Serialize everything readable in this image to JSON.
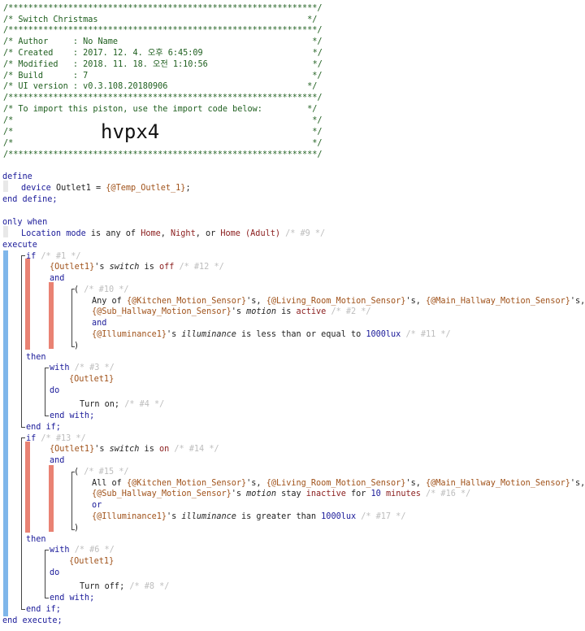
{
  "header": {
    "rule": "/**************************************************************/",
    "title_row": "/* Switch Christmas                                          */",
    "author_row": "/* Author     : No Name                                       */",
    "created_row": "/* Created    : 2017. 12. 4. 오후 6:45:09                      */",
    "modified_row": "/* Modified   : 2018. 11. 18. 오전 1:10:56                     */",
    "build_row": "/* Build      : 7                                             */",
    "ui_row": "/* UI version : v0.3.108.20180906                            */",
    "import_row": "/* To import this piston, use the import code below:         */",
    "blank_row": "/*                                                            */",
    "import_code": "hvpx4"
  },
  "code": {
    "define": "define",
    "device_kw": "device",
    "device_name": "Outlet1",
    "eq": " = ",
    "device_value": "{@Temp_Outlet_1}",
    "semi": ";",
    "end_define": "end define;",
    "only_when": "only when",
    "location_mode": "Location mode",
    "is_any_of": " is any of ",
    "mode_home": "Home",
    "comma": ", ",
    "mode_night": "Night",
    "or_text": ", or ",
    "mode_home_adult": "Home (Adult)",
    "cond9": "/* #9 */",
    "execute": "execute",
    "if1": "if",
    "c1": "/* #1 */",
    "outlet_ref": "{Outlet1}",
    "apos_s": "'s ",
    "switch_attr": "switch",
    "is_text": " is ",
    "off_val": "off",
    "c12": "/* #12 */",
    "and_text": "and",
    "paren_open": "(",
    "c10": "/* #10 */",
    "any_of": "Any of ",
    "kitchen": "{@Kitchen_Motion_Sensor}",
    "apos_s_comma": "'s, ",
    "living": "{@Living_Room_Motion_Sensor}",
    "main_hall": "{@Main_Hallway_Motion_Sensor}",
    "apos_s_or": "'s, or",
    "sub_hall": "{@Sub_Hallway_Motion_Sensor}",
    "motion_attr": "motion",
    "active_val": "active",
    "c2": "/* #2 */",
    "illum_ref": "{@Illuminance1}",
    "illum_attr": "illuminance",
    "less_eq": " is less than or equal to ",
    "lux_val": "1000lux",
    "c11": "/* #11 */",
    "paren_close": ")",
    "then_text": "then",
    "with_text": "with",
    "c3": "/* #3 */",
    "do_text": "do",
    "turn_on": "Turn on;",
    "c4": "/* #4 */",
    "end_with": "end with;",
    "end_if": "end if;",
    "if2": "if",
    "c13": "/* #13 */",
    "on_val": "on",
    "c14": "/* #14 */",
    "c15": "/* #15 */",
    "all_of": "All of ",
    "apos_s_and": "'s, and",
    "stay": " stay ",
    "inactive_val": "inactive",
    "for_text": " for ",
    "ten_val": "10",
    "minutes_val": "minutes",
    "c16": "/* #16 */",
    "or_kw": "or",
    "greater": " is greater than ",
    "c17": "/* #17 */",
    "c6": "/* #6 */",
    "turn_off": "Turn off;",
    "c8": "/* #8 */",
    "end_execute": "end execute;"
  },
  "colors": {
    "keyword": "#1a1a99",
    "comment": "#bdbdbd",
    "variable": "#a0521a",
    "value": "#8a1c1c",
    "header": "#1f5f1f",
    "bar_blue": "#7fb6ea",
    "bar_red": "#e98273"
  }
}
